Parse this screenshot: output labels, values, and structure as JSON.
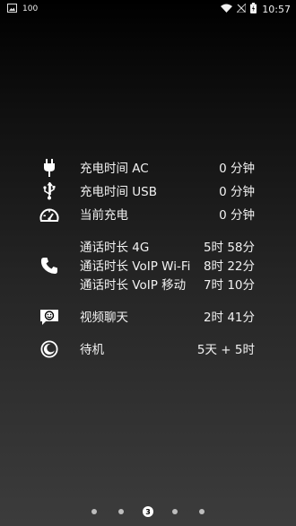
{
  "status_bar": {
    "notification_count": "100",
    "time": "10:57",
    "icons": [
      "image-icon",
      "wifi-icon",
      "no-signal-icon",
      "battery-charging-icon"
    ]
  },
  "usage": {
    "charge_ac": {
      "label": "充电时间 AC",
      "value": "0 分钟",
      "icon": "plug-icon"
    },
    "charge_usb": {
      "label": "充电时间 USB",
      "value": "0 分钟",
      "icon": "usb-icon"
    },
    "current_charge": {
      "label": "当前充电",
      "value": "0 分钟",
      "icon": "speedometer-icon"
    },
    "calls": {
      "icon": "phone-icon",
      "items": [
        {
          "label": "通话时长 4G",
          "value": "5时 58分"
        },
        {
          "label": "通话时长 VoIP Wi-Fi",
          "value": "8时 22分"
        },
        {
          "label": "通话时长 VoIP 移动",
          "value": "7时 10分"
        }
      ]
    },
    "video_chat": {
      "label": "视频聊天",
      "value": "2时 41分",
      "icon": "video-chat-icon"
    },
    "standby": {
      "label": "待机",
      "value": "5天 + 5时",
      "icon": "moon-icon"
    }
  },
  "pager": {
    "current_page": "3",
    "total_pages": 5
  }
}
